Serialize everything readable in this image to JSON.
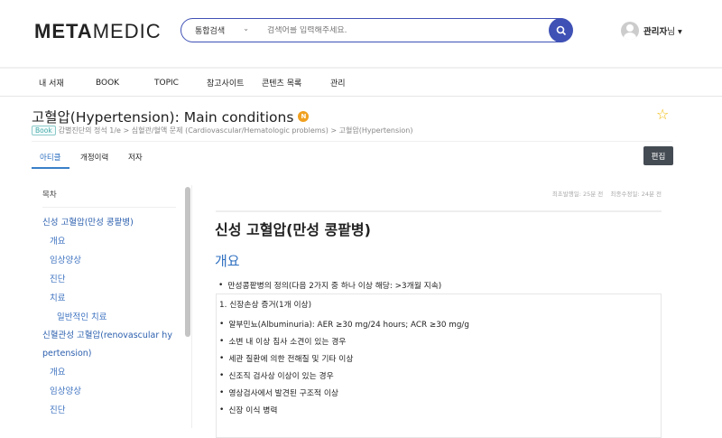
{
  "header": {
    "logo_bold": "META",
    "logo_light": "MEDIC",
    "search_scope": "통합검색",
    "search_placeholder": "검색어를 입력해주세요.",
    "user_name": "관리자",
    "user_suffix": "님 ▾"
  },
  "nav": [
    "내 서재",
    "BOOK",
    "TOPIC",
    "참고사이트",
    "콘텐츠 목록",
    "관리"
  ],
  "page": {
    "title": "고혈압(Hypertension): Main conditions",
    "title_badge": "N",
    "book_badge": "Book",
    "breadcrumb": "감별진단의 정석 1/e > 심혈관/혈액 문제 (Cardiovascular/Hematologic problems) > 고혈압(Hypertension)",
    "tabs": [
      "아티클",
      "개정이력",
      "저자"
    ],
    "edit_label": "편집"
  },
  "toc": {
    "heading": "목차",
    "items": [
      {
        "label": "신성 고혈압(만성 콩팥병)",
        "level": 1
      },
      {
        "label": "개요",
        "level": 2
      },
      {
        "label": "임상양상",
        "level": 2
      },
      {
        "label": "진단",
        "level": 2
      },
      {
        "label": "치료",
        "level": 2
      },
      {
        "label": "일반적인 치료",
        "level": 3
      },
      {
        "label": "신혈관성 고혈압(renovascular hypertension)",
        "level": 1
      },
      {
        "label": "개요",
        "level": 2
      },
      {
        "label": "임상양상",
        "level": 2
      },
      {
        "label": "진단",
        "level": 2
      }
    ]
  },
  "article": {
    "meta": "최초발행일: 25분 전    최종수정일: 24분 전",
    "h1": "신성 고혈압(만성 콩팥병)",
    "h2": "개요",
    "bullet": "만성콩팥병의 정의(다음 2가지 중 하나 이상 해당: >3개월 지속)",
    "box_title": "1. 신장손상 증거(1개 이상)",
    "box_items": [
      "알부민뇨(Albuminuria): AER ≥30 mg/24 hours; ACR ≥30 mg/g",
      "소변 내 이상 침사 소견이 있는 경우",
      "세관 질환에 의한 전해질 및 기타 이상",
      "신조직 검사상 이상이 있는 경우",
      "영상검사에서 발견된 구조적 이상",
      "신장 이식 병력"
    ]
  },
  "colors": {
    "accent": "#3f51b5",
    "link": "#2b5fae",
    "star": "#f0b800"
  }
}
